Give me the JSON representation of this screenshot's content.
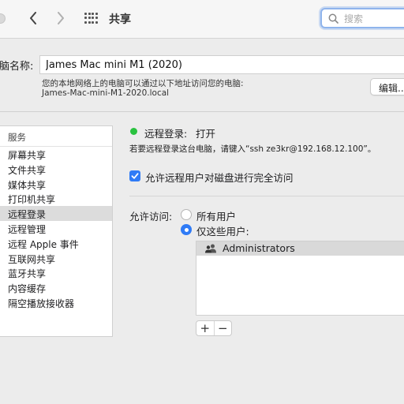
{
  "window": {
    "title": "共享"
  },
  "search": {
    "placeholder": "搜索"
  },
  "computer_name": {
    "label": "脑名称:",
    "value": "James Mac mini M1 (2020)",
    "address_line1": "您的本地网络上的电脑可以通过以下地址访问您的电脑:",
    "address_line2": "James-Mac-mini-M1-2020.local",
    "edit_label": "编辑..."
  },
  "services": {
    "header": "服务",
    "items": [
      {
        "label": "屏幕共享",
        "selected": false
      },
      {
        "label": "文件共享",
        "selected": false
      },
      {
        "label": "媒体共享",
        "selected": false
      },
      {
        "label": "打印机共享",
        "selected": false
      },
      {
        "label": "远程登录",
        "selected": true
      },
      {
        "label": "远程管理",
        "selected": false
      },
      {
        "label": "远程 Apple 事件",
        "selected": false
      },
      {
        "label": "互联网共享",
        "selected": false
      },
      {
        "label": "蓝牙共享",
        "selected": false
      },
      {
        "label": "内容缓存",
        "selected": false
      },
      {
        "label": "隔空播放接收器",
        "selected": false
      }
    ]
  },
  "detail": {
    "status_label": "远程登录:",
    "status_value": "打开",
    "status_color": "#29c23f",
    "hint": "若要远程登录这台电脑，请键入“ssh ze3kr@192.168.12.100”。",
    "full_disk_label": "允许远程用户对磁盘进行完全访问",
    "full_disk_checked": true,
    "access_label": "允许访问:",
    "option_all": "所有用户",
    "option_only": "仅这些用户:",
    "selected_option": "only",
    "users": [
      {
        "name": "Administrators",
        "icon": "group-icon"
      }
    ],
    "add_label": "+",
    "remove_label": "−"
  },
  "colors": {
    "accent": "#2f7bf6",
    "selection": "#dcdcdc"
  }
}
